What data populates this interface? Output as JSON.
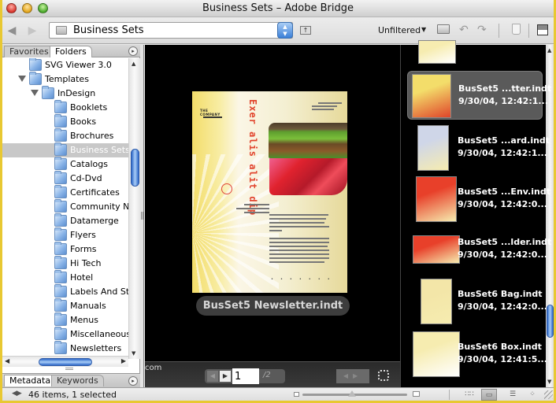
{
  "window": {
    "title": "Business Sets – Adobe Bridge"
  },
  "toolbar": {
    "back_icon": "back-arrow-icon",
    "forward_icon": "forward-arrow-icon",
    "path_value": "Business Sets",
    "path_stepper_glyph": "▲▼",
    "up_folder_glyph": "↑",
    "filter_label": "Unfiltered",
    "filter_caret": "▼",
    "rotate_left_glyph": "↶",
    "rotate_right_glyph": "↷"
  },
  "left_panel": {
    "tabs": [
      "Favorites",
      "Folders"
    ],
    "active_tab": "Folders",
    "menu_glyph": "▸",
    "tree": [
      {
        "label": "SVG Viewer 3.0",
        "depth": 1,
        "expanded": null,
        "selected": false
      },
      {
        "label": "Templates",
        "depth": 1,
        "expanded": true,
        "selected": false
      },
      {
        "label": "InDesign",
        "depth": 2,
        "expanded": true,
        "selected": false
      },
      {
        "label": "Booklets",
        "depth": 3,
        "expanded": null,
        "selected": false
      },
      {
        "label": "Books",
        "depth": 3,
        "expanded": null,
        "selected": false
      },
      {
        "label": "Brochures",
        "depth": 3,
        "expanded": null,
        "selected": false
      },
      {
        "label": "Business Sets",
        "depth": 3,
        "expanded": null,
        "selected": true
      },
      {
        "label": "Catalogs",
        "depth": 3,
        "expanded": null,
        "selected": false
      },
      {
        "label": "Cd-Dvd",
        "depth": 3,
        "expanded": null,
        "selected": false
      },
      {
        "label": "Certificates",
        "depth": 3,
        "expanded": null,
        "selected": false
      },
      {
        "label": "Community Newsletters",
        "depth": 3,
        "expanded": null,
        "selected": false
      },
      {
        "label": "Datamerge",
        "depth": 3,
        "expanded": null,
        "selected": false
      },
      {
        "label": "Flyers",
        "depth": 3,
        "expanded": null,
        "selected": false
      },
      {
        "label": "Forms",
        "depth": 3,
        "expanded": null,
        "selected": false
      },
      {
        "label": "Hi Tech",
        "depth": 3,
        "expanded": null,
        "selected": false
      },
      {
        "label": "Hotel",
        "depth": 3,
        "expanded": null,
        "selected": false
      },
      {
        "label": "Labels And Stickers",
        "depth": 3,
        "expanded": null,
        "selected": false
      },
      {
        "label": "Manuals",
        "depth": 3,
        "expanded": null,
        "selected": false
      },
      {
        "label": "Menus",
        "depth": 3,
        "expanded": null,
        "selected": false
      },
      {
        "label": "Miscellaneous",
        "depth": 3,
        "expanded": null,
        "selected": false
      },
      {
        "label": "Newsletters",
        "depth": 3,
        "expanded": null,
        "selected": false
      }
    ],
    "bottom_tabs": [
      "Metadata",
      "Keywords"
    ],
    "bottom_active_tab": "Metadata"
  },
  "preview": {
    "document_title": "BusSet5 Newsletter.indt",
    "headline": "Exer alis alit dip",
    "masthead": "THE COMPANY",
    "url_fragment": "com",
    "page_current": "1",
    "page_total": "/2",
    "prev_glyph": "◀",
    "next_glyph": "▶",
    "nav_glyphs": "◀▶"
  },
  "content": {
    "items": [
      {
        "name": "",
        "date": "",
        "partial": true,
        "selected": false,
        "colors": [
          "#f6ecb0",
          "#ffffff"
        ]
      },
      {
        "name": "BusSet5 ...tter.indt",
        "date": "9/30/04, 12:42:1...",
        "selected": true,
        "colors": [
          "#f3dd6a",
          "#e0452a"
        ]
      },
      {
        "name": "BusSet5 ...ard.indt",
        "date": "9/30/04, 12:42:1...",
        "selected": false,
        "colors": [
          "#cfd6e8",
          "#f6ecb0"
        ]
      },
      {
        "name": "BusSet5 ...Env.indt",
        "date": "9/30/04, 12:42:0...",
        "selected": false,
        "colors": [
          "#e8402a",
          "#f6ecb0"
        ]
      },
      {
        "name": "BusSet5 ...lder.indt",
        "date": "9/30/04, 12:42:0...",
        "selected": false,
        "colors": [
          "#e8402a",
          "#f6ecb0"
        ]
      },
      {
        "name": "BusSet6 Bag.indt",
        "date": "9/30/04, 12:42:0...",
        "selected": false,
        "colors": [
          "#f3e6a8",
          "#f6ecb0"
        ]
      },
      {
        "name": "BusSet6 Box.indt",
        "date": "9/30/04, 12:41:5...",
        "selected": false,
        "colors": [
          "#f6ecb0",
          "#ffffff"
        ]
      }
    ]
  },
  "statusbar": {
    "toggle_glyph": "◀▶",
    "text": "46 items, 1 selected",
    "view_modes": [
      {
        "name": "thumbnails-view",
        "glyph": "∷∷",
        "active": false
      },
      {
        "name": "filmstrip-view",
        "glyph": "▭",
        "active": true
      },
      {
        "name": "details-view",
        "glyph": "☰",
        "active": false
      },
      {
        "name": "versions-view",
        "glyph": "⁘",
        "active": false
      }
    ]
  }
}
